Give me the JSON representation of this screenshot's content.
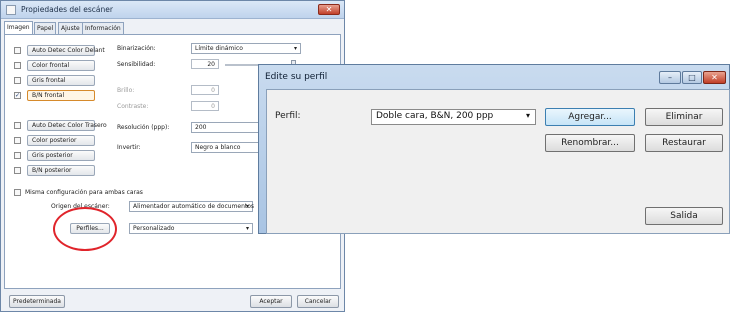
{
  "scanner_window": {
    "title": "Propiedades del escáner",
    "tabs": [
      "Imagen",
      "Papel",
      "Ajuste",
      "Información"
    ],
    "image_buttons": [
      {
        "label": "Auto Detec Color Delant",
        "checked": false
      },
      {
        "label": "Color frontal",
        "checked": false
      },
      {
        "label": "Gris frontal",
        "checked": false
      },
      {
        "label": "B/N frontal",
        "checked": true
      },
      {
        "label": "Auto Detec Color Trasero",
        "checked": false
      },
      {
        "label": "Color posterior",
        "checked": false
      },
      {
        "label": "Gris posterior",
        "checked": false
      },
      {
        "label": "B/N posterior",
        "checked": false
      }
    ],
    "binarization_label": "Binarización:",
    "binarization_value": "Límite dinámico",
    "sensitivity_label": "Sensibilidad:",
    "sensitivity_value": "20",
    "brightness_label": "Brillo:",
    "brightness_value": "0",
    "contrast_label": "Contraste:",
    "contrast_value": "0",
    "resolution_label": "Resolución (ppp):",
    "resolution_value": "200",
    "invert_label": "Invertir:",
    "invert_value": "Negro a blanco",
    "same_config_label": "Misma configuración para ambas caras",
    "same_config_checked": false,
    "source_label": "Origen del escáner:",
    "source_value": "Alimentador automático de documentos",
    "profiles_button": "Perfiles...",
    "profile_value": "Personalizado",
    "default_button": "Predeterminada",
    "accept_button": "Aceptar",
    "cancel_button": "Cancelar"
  },
  "profile_dialog": {
    "title": "Edite su perfil",
    "profile_label": "Perfil:",
    "profile_value": "Doble cara, B&N, 200 ppp",
    "add_button": "Agregar...",
    "delete_button": "Eliminar",
    "rename_button": "Renombrar...",
    "restore_button": "Restaurar",
    "exit_button": "Salida",
    "minimize_glyph": "–",
    "maximize_glyph": "□",
    "close_glyph": "✕"
  },
  "colors": {
    "highlight_circle": "#e0242b",
    "dialog_title_gradient": "#a9c4e3"
  }
}
